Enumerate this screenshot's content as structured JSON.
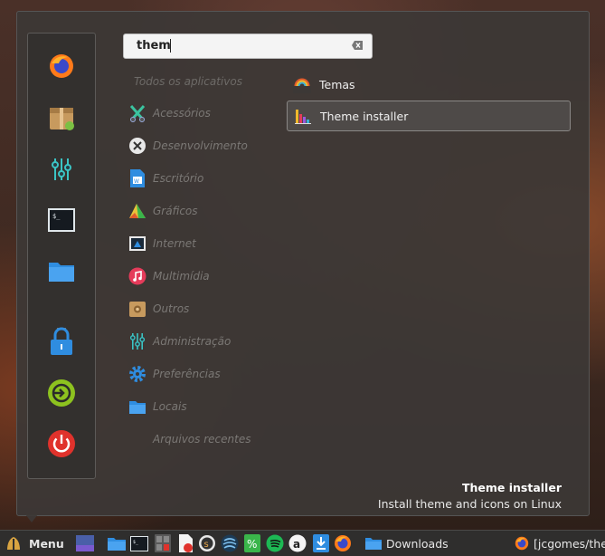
{
  "search": {
    "value": "them"
  },
  "categories_header": "Todos os aplicativos",
  "categories": [
    {
      "label": "Acessórios",
      "icon": "accessories-icon"
    },
    {
      "label": "Desenvolvimento",
      "icon": "development-icon"
    },
    {
      "label": "Escritório",
      "icon": "office-icon"
    },
    {
      "label": "Gráficos",
      "icon": "graphics-icon"
    },
    {
      "label": "Internet",
      "icon": "internet-icon"
    },
    {
      "label": "Multimídia",
      "icon": "multimedia-icon"
    },
    {
      "label": "Outros",
      "icon": "others-icon"
    },
    {
      "label": "Administração",
      "icon": "administration-icon"
    },
    {
      "label": "Preferências",
      "icon": "preferences-icon"
    },
    {
      "label": "Locais",
      "icon": "places-icon"
    },
    {
      "label": "Arquivos recentes",
      "icon": ""
    }
  ],
  "results": [
    {
      "label": "Temas",
      "icon": "themes-icon"
    },
    {
      "label": "Theme installer",
      "icon": "theme-installer-icon"
    }
  ],
  "description": {
    "title": "Theme installer",
    "text": "Install theme and icons on Linux"
  },
  "favorites": [
    "firefox-icon",
    "package-installer-icon",
    "settings-mixer-icon",
    "terminal-icon",
    "folder-icon",
    "lock-icon",
    "logout-icon",
    "power-icon"
  ],
  "taskbar": {
    "menu_label": "Menu",
    "windows": [
      {
        "label": "Downloads",
        "icon": "folder-icon"
      },
      {
        "label": "[jcgomes/the",
        "icon": "firefox-icon"
      }
    ]
  },
  "colors": {
    "accent_blue": "#2f8de0",
    "power_red": "#e0322c",
    "logout_green": "#8dc21f"
  }
}
